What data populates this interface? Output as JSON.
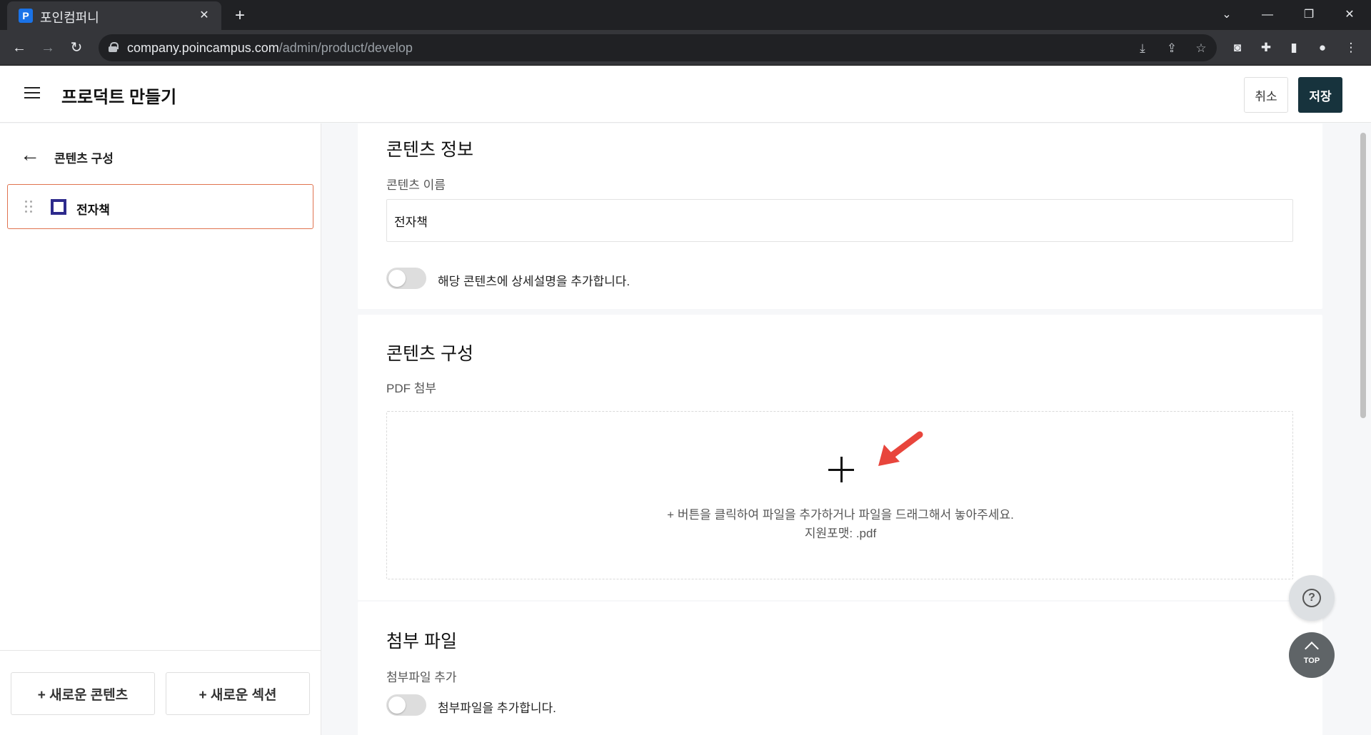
{
  "browser": {
    "tab_title": "포인컴퍼니",
    "favicon_letter": "P",
    "url_host": "company.poincampus.com",
    "url_path": "/admin/product/develop"
  },
  "header": {
    "title": "프로덕트 만들기",
    "cancel_label": "취소",
    "save_label": "저장"
  },
  "sidebar": {
    "back_label": "콘텐츠 구성",
    "items": [
      {
        "label": "전자책"
      }
    ],
    "new_content_label": "+ 새로운 콘텐츠",
    "new_section_label": "+ 새로운 섹션"
  },
  "content_info": {
    "title": "콘텐츠 정보",
    "name_label": "콘텐츠 이름",
    "name_value": "전자책",
    "toggle_label": "해당 콘텐츠에 상세설명을 추가합니다."
  },
  "content_composition": {
    "title": "콘텐츠 구성",
    "pdf_label": "PDF 첨부",
    "drop_hint": "+ 버튼을 클릭하여 파일을 추가하거나 파일을 드래그해서 놓아주세요.",
    "supported_format": "지원포맷: .pdf"
  },
  "attachments": {
    "title": "첨부 파일",
    "add_label": "첨부파일 추가",
    "toggle_label": "첨부파일을 추가합니다."
  },
  "floating": {
    "top_label": "TOP"
  },
  "colors": {
    "save_button": "#17333d",
    "selected_border": "#e0734f",
    "ebook_icon": "#2d2a8c",
    "annotation_arrow": "#e8453c"
  }
}
